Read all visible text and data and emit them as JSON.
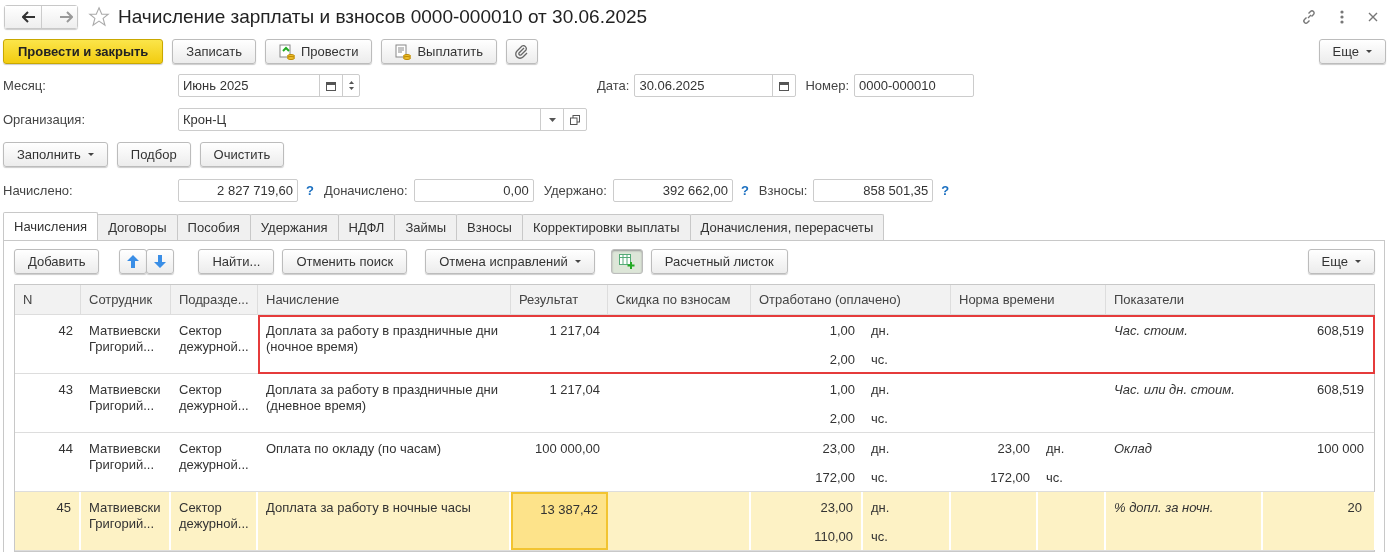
{
  "window": {
    "title": "Начисление зарплаты и взносов 0000-000010 от 30.06.2025",
    "favorite": false
  },
  "toolbar": {
    "buttons": [
      {
        "label": "Провести и закрыть",
        "kind": "primary"
      },
      {
        "label": "Записать",
        "kind": "plain"
      },
      {
        "label": "Провести",
        "kind": "post"
      },
      {
        "label": "Выплатить",
        "kind": "pay"
      },
      {
        "kind": "attach"
      }
    ],
    "more": "Еще"
  },
  "month": {
    "label": "Месяц:",
    "value": "Июнь 2025"
  },
  "date": {
    "label": "Дата:",
    "value": "30.06.2025"
  },
  "number": {
    "label": "Номер:",
    "value": "0000-000010"
  },
  "organization": {
    "label": "Организация:",
    "value": "Крон-Ц"
  },
  "fill_buttons": [
    {
      "label": "Заполнить",
      "dropdown": true
    },
    {
      "label": "Подбор",
      "dropdown": false
    },
    {
      "label": "Очистить",
      "dropdown": false
    }
  ],
  "totals": [
    {
      "label": "Начислено:",
      "value": "2 827 719,60",
      "help": "?"
    },
    {
      "label": "Доначислено:",
      "value": "0,00"
    },
    {
      "label": "Удержано:",
      "value": "392 662,00",
      "help": "?"
    },
    {
      "label": "Взносы:",
      "value": "858 501,35",
      "help": "?"
    }
  ],
  "tabs": [
    {
      "label": "Начисления",
      "selected": true
    },
    {
      "label": "Договоры",
      "selected": false
    },
    {
      "label": "Пособия",
      "selected": false
    },
    {
      "label": "Удержания",
      "selected": false
    },
    {
      "label": "НДФЛ",
      "selected": false
    },
    {
      "label": "Займы",
      "selected": false
    },
    {
      "label": "Взносы",
      "selected": false
    },
    {
      "label": "Корректировки выплаты",
      "selected": false
    },
    {
      "label": "Доначисления, перерасчеты",
      "selected": false
    }
  ],
  "table_toolbar": {
    "add": "Добавить",
    "find": "Найти...",
    "cancel_search": "Отменить поиск",
    "undo": "Отмена исправлений",
    "grid_pressed": true,
    "payslip": "Расчетный листок",
    "more": "Еще"
  },
  "table": {
    "columns": [
      "N",
      "Сотрудник",
      "Подразде...",
      "Начисление",
      "Результат",
      "Скидка по взносам",
      "Отработано (оплачено)",
      "Норма времени",
      "Показатели"
    ],
    "rows": [
      {
        "n": "42",
        "employee": "Матвиевски Григорий...",
        "department": "Сектор дежурной...",
        "accrual": "Доплата за работу в праздничные дни (ночное время)",
        "result": "1 217,04",
        "worked": [
          {
            "value": "1,00",
            "unit": "дн."
          },
          {
            "value": "2,00",
            "unit": "чс."
          }
        ],
        "norm": [],
        "indicator": "Час. стоим.",
        "indicator_value": "608,519",
        "selected": false,
        "highlighted": true
      },
      {
        "n": "43",
        "employee": "Матвиевски Григорий...",
        "department": "Сектор дежурной...",
        "accrual": "Доплата за работу в праздничные дни (дневное время)",
        "result": "1 217,04",
        "worked": [
          {
            "value": "1,00",
            "unit": "дн."
          },
          {
            "value": "2,00",
            "unit": "чс."
          }
        ],
        "norm": [],
        "indicator": "Час. или дн. стоим.",
        "indicator_value": "608,519",
        "selected": false,
        "highlighted": false
      },
      {
        "n": "44",
        "employee": "Матвиевски Григорий...",
        "department": "Сектор дежурной...",
        "accrual": "Оплата по окладу (по часам)",
        "result": "100 000,00",
        "worked": [
          {
            "value": "23,00",
            "unit": "дн."
          },
          {
            "value": "172,00",
            "unit": "чс."
          }
        ],
        "norm": [
          {
            "value": "23,00",
            "unit": "дн."
          },
          {
            "value": "172,00",
            "unit": "чс."
          }
        ],
        "indicator": "Оклад",
        "indicator_value": "100 000",
        "selected": false,
        "highlighted": false
      },
      {
        "n": "45",
        "employee": "Матвиевски Григорий...",
        "department": "Сектор дежурной...",
        "accrual": "Доплата за работу в ночные часы",
        "result": "13 387,42",
        "worked": [
          {
            "value": "23,00",
            "unit": "дн."
          },
          {
            "value": "110,00",
            "unit": "чс."
          }
        ],
        "norm": [],
        "indicator": "% допл. за ночн.",
        "indicator_value": "20",
        "selected": true,
        "highlighted": false
      }
    ]
  }
}
